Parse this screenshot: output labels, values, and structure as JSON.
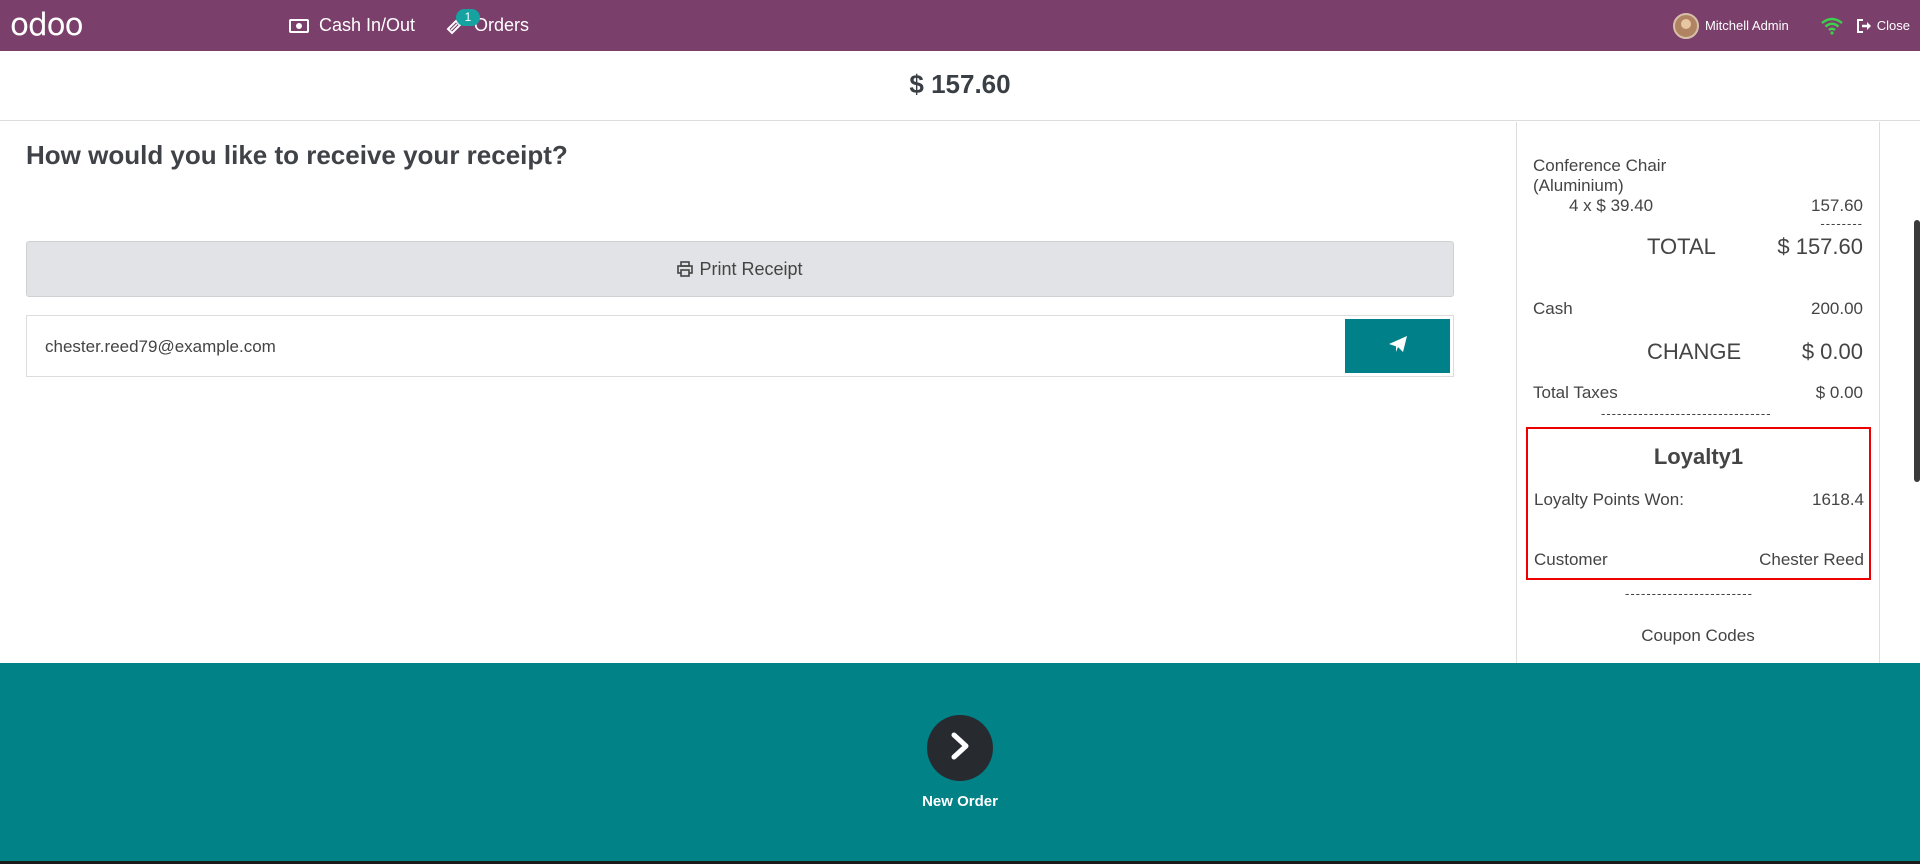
{
  "navbar": {
    "logo": "odoo",
    "cash_in_out": "Cash In/Out",
    "orders": "Orders",
    "orders_badge": "1",
    "user_name": "Mitchell Admin",
    "close": "Close"
  },
  "header": {
    "amount": "$ 157.60"
  },
  "main": {
    "question": "How would you like to receive your receipt?",
    "print_button": "Print Receipt",
    "email_value": "chester.reed79@example.com"
  },
  "receipt": {
    "item_name_line1": "Conference Chair",
    "item_name_line2": "(Aluminium)",
    "item_qty_price": "4 x $ 39.40",
    "item_total": "157.60",
    "dashes_short": "--------",
    "total_label": "TOTAL",
    "total_value": "$ 157.60",
    "cash_label": "Cash",
    "cash_value": "200.00",
    "change_label": "CHANGE",
    "change_value": "$ 0.00",
    "taxes_label": "Total Taxes",
    "taxes_value": "$ 0.00",
    "dashes_mid": "--------------------------------",
    "loyalty": {
      "title": "Loyalty1",
      "points_label": "Loyalty Points Won:",
      "points_value": "1618.4",
      "customer_label": "Customer",
      "customer_value": "Chester Reed"
    },
    "dashes_bottom": "------------------------",
    "coupon_title": "Coupon Codes"
  },
  "footer": {
    "new_order": "New Order"
  },
  "colors": {
    "navbar": "#7a3f6b",
    "accent": "#00818a",
    "footer": "#008286",
    "highlight_border": "#e00000"
  }
}
